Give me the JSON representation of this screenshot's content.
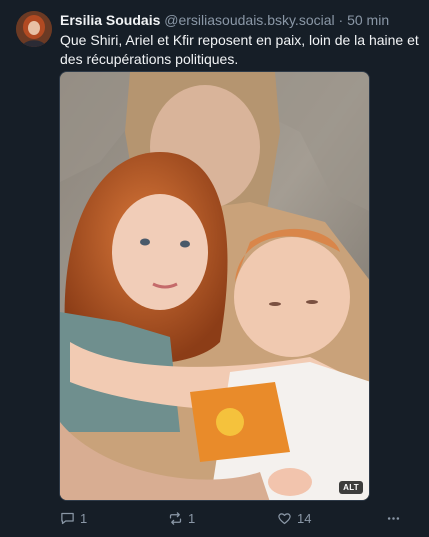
{
  "post": {
    "author_name": "Ersilia Soudais",
    "author_handle": "@ersiliasoudais.bsky.social",
    "separator": "·",
    "time": "50 min",
    "text": "Que Shiri, Ariel et Kfir reposent en paix, loin de la haine et des récupérations politiques.",
    "image_alt_badge": "ALT"
  },
  "actions": {
    "replies": "1",
    "reposts": "1",
    "likes": "14"
  },
  "icons": {
    "reply": "speech-bubble-icon",
    "repost": "repost-arrows-icon",
    "like": "heart-icon",
    "more": "more-dots-icon"
  },
  "colors": {
    "background": "#161e27",
    "text": "#f1f3f5",
    "muted": "#8a97a6"
  }
}
